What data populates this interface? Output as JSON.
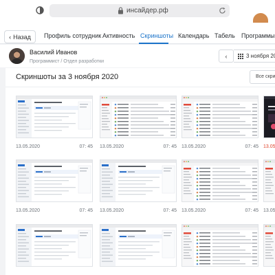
{
  "browser": {
    "url": "инсайдер.рф",
    "icons": [
      "shield-icon",
      "lock-icon",
      "reload-icon"
    ]
  },
  "nav": {
    "back_label": "Назад",
    "tabs": [
      {
        "label": "Профиль сотрудник",
        "active": false
      },
      {
        "label": "Активность",
        "active": false
      },
      {
        "label": "Скриншоты",
        "active": true
      },
      {
        "label": "Календарь",
        "active": false
      },
      {
        "label": "Табель",
        "active": false
      },
      {
        "label": "Программы",
        "active": false
      }
    ]
  },
  "user": {
    "name": "Василий Иванов",
    "role": "Программист / Отдел разработки",
    "date_label": "3 ноября 202"
  },
  "screenshots": {
    "title": "Скриншоты за 3 ноября 2020",
    "all_button": "Все скри",
    "items": [
      {
        "date": "13.05.2020",
        "time": "07: 45",
        "variant": "blue-app"
      },
      {
        "date": "13.05.2020",
        "time": "07: 45",
        "variant": "mail"
      },
      {
        "date": "13.05.2020",
        "time": "07: 45",
        "variant": "mail"
      },
      {
        "date": "13.05",
        "time": "",
        "variant": "dark",
        "alert": true
      },
      {
        "date": "13.05.2020",
        "time": "07: 45",
        "variant": "blue-app"
      },
      {
        "date": "13.05.2020",
        "time": "07: 45",
        "variant": "blue-app"
      },
      {
        "date": "13.05.2020",
        "time": "07: 45",
        "variant": "mail"
      },
      {
        "date": "13.05",
        "time": "",
        "variant": "mail"
      },
      {
        "date": "",
        "time": "",
        "variant": "blue-app"
      },
      {
        "date": "",
        "time": "",
        "variant": "blue-app"
      },
      {
        "date": "",
        "time": "",
        "variant": "mail"
      },
      {
        "date": "",
        "time": "",
        "variant": "mail"
      }
    ]
  },
  "colors": {
    "accent": "#1a73c9",
    "alert": "#e0442c",
    "page_bg": "#f2f3f5"
  }
}
